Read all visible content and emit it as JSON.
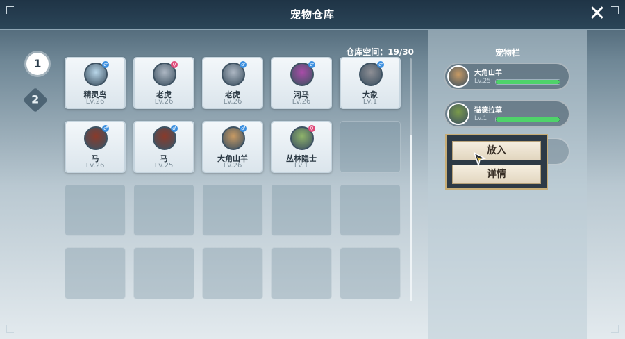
{
  "window": {
    "title": "宠物仓库"
  },
  "pages": [
    "1",
    "2"
  ],
  "storage": {
    "capacity": "仓库空间：19/30"
  },
  "slots": [
    {
      "name": "精灵鸟",
      "level": "Lv.26",
      "gender": "male",
      "icon": "bird-icon",
      "color": "#b9d7ea"
    },
    {
      "name": "老虎",
      "level": "Lv.26",
      "gender": "female",
      "icon": "white-tiger-icon",
      "color": "#aeb8c4"
    },
    {
      "name": "老虎",
      "level": "Lv.26",
      "gender": "male",
      "icon": "white-tiger-icon",
      "color": "#aeb8c4"
    },
    {
      "name": "河马",
      "level": "Lv.26",
      "gender": "male",
      "icon": "hippo-icon",
      "color": "#a94ca8"
    },
    {
      "name": "大象",
      "level": "Lv.1",
      "gender": "male",
      "icon": "elephant-icon",
      "color": "#8e8f95"
    },
    {
      "name": "马",
      "level": "Lv.26",
      "gender": "male",
      "icon": "horse-icon",
      "color": "#8a3a2a"
    },
    {
      "name": "马",
      "level": "Lv.25",
      "gender": "male",
      "icon": "horse-icon",
      "color": "#8a3a2a"
    },
    {
      "name": "大角山羊",
      "level": "Lv.26",
      "gender": "male",
      "icon": "goat-icon",
      "color": "#c89a63"
    },
    {
      "name": "丛林隐士",
      "level": "Lv.1",
      "gender": "female",
      "icon": "jungle-hermit-icon",
      "color": "#8fb36a"
    }
  ],
  "team": {
    "title": "宠物栏",
    "members": [
      {
        "name": "大角山羊",
        "level": "Lv.25",
        "hp": 1.0,
        "icon": "goat-icon",
        "color": "#c89a63"
      },
      {
        "name": "猫德拉草",
        "level": "Lv.1",
        "hp": 1.0,
        "icon": "mandrake-cat-icon",
        "color": "#7a9a4a"
      }
    ]
  },
  "context_menu": {
    "put": "放入",
    "detail": "详情"
  },
  "colors": {
    "male": "#3b8fe0",
    "female": "#e04a7a",
    "hp": "#4fd36a"
  }
}
